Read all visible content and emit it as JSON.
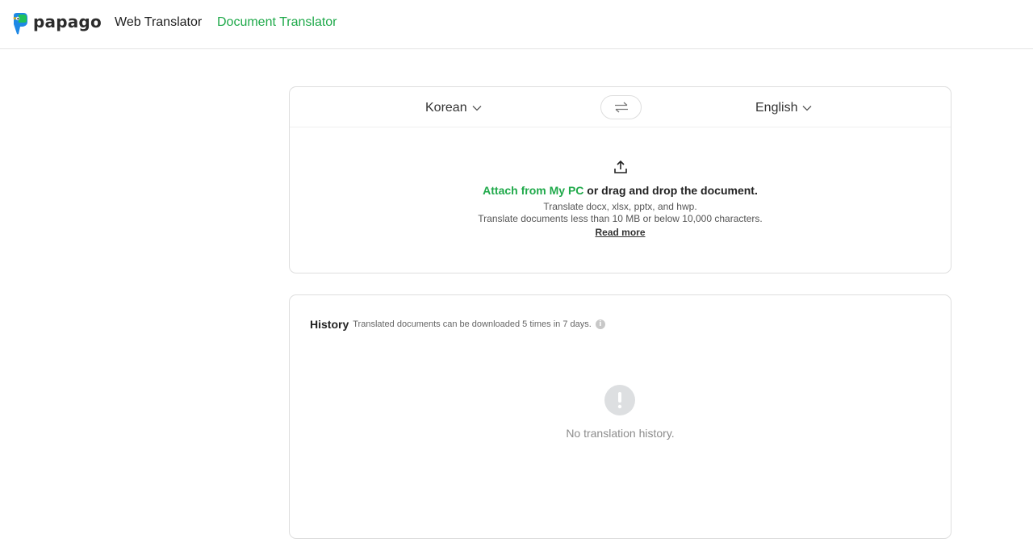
{
  "header": {
    "logo_text": "papago",
    "nav": {
      "web_translator": "Web Translator",
      "document_translator": "Document Translator"
    }
  },
  "translator": {
    "source_language": "Korean",
    "target_language": "English",
    "upload": {
      "attach_link": "Attach from My PC",
      "attach_rest": " or drag and drop the document.",
      "info_formats": "Translate docx, xlsx, pptx, and hwp.",
      "info_limits": "Translate documents less than 10 MB or below 10,000 characters.",
      "read_more": "Read more"
    }
  },
  "history": {
    "title": "History",
    "note": "Translated documents can be downloaded 5 times in 7 days.",
    "info_icon_glyph": "i",
    "empty_text": "No translation history."
  },
  "colors": {
    "brand_green": "#1fa94a",
    "logo_blue": "#1e88e5",
    "logo_green": "#20c15a"
  },
  "icons": [
    "papago-logo-icon",
    "chevron-down-icon",
    "swap-icon",
    "upload-icon",
    "info-icon",
    "exclamation-icon"
  ]
}
